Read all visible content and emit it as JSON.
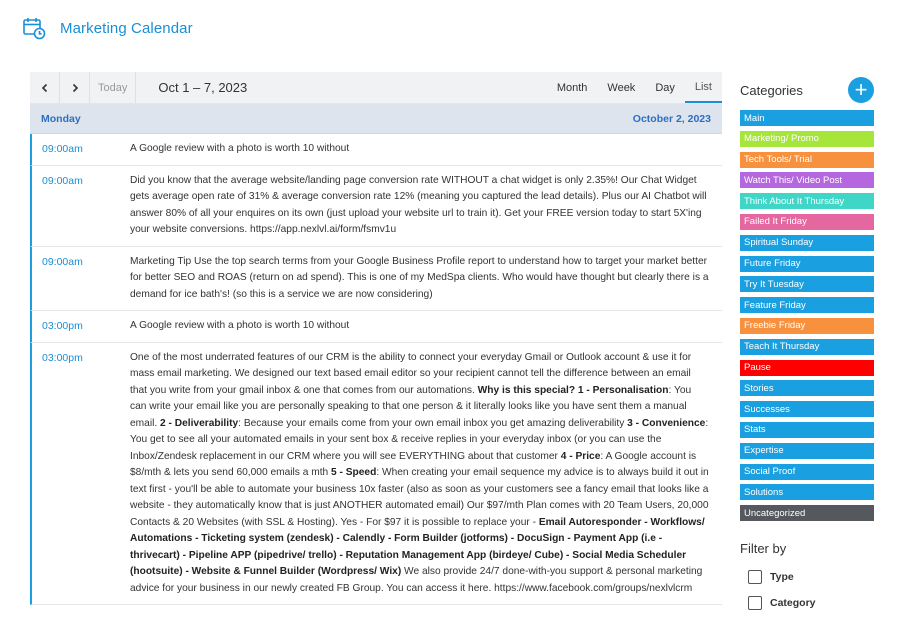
{
  "header": {
    "title": "Marketing Calendar"
  },
  "toolbar": {
    "prev": "‹",
    "next": "›",
    "today": "Today",
    "range": "Oct 1 – 7, 2023",
    "views": [
      "Month",
      "Week",
      "Day",
      "List"
    ],
    "active_view": "List"
  },
  "day": {
    "name": "Monday",
    "date": "October 2, 2023"
  },
  "events": [
    {
      "time": "09:00am",
      "html": "A Google review with a photo is worth 10 without"
    },
    {
      "time": "09:00am",
      "html": "Did you know that the average website/landing page conversion rate WITHOUT a chat widget is only 2.35%! Our Chat Widget gets average open rate of 31% &amp; average conversion rate 12% (meaning you captured the lead details). Plus our AI Chatbot will answer 80% of all your enquires on its own (just upload your website url to train it). Get your FREE version today to start 5X'ing your website conversions. https://app.nexlvl.ai/form/fsmv1u"
    },
    {
      "time": "09:00am",
      "html": "Marketing Tip Use the top search terms from your Google Business Profile report to understand how to target your market better for better SEO and ROAS (return on ad spend). This is one of my MedSpa clients. Who would have thought but clearly there is a demand for ice bath's! (so this is a service we are now considering)"
    },
    {
      "time": "03:00pm",
      "html": "A Google review with a photo is worth 10 without"
    },
    {
      "time": "03:00pm",
      "html": "One of the most underrated features of our CRM is the ability to connect your everyday Gmail or Outlook account &amp; use it for mass email marketing. We designed our text based email editor so your recipient cannot tell the difference between an email that you write from your gmail inbox &amp; one that comes from our automations. <b>Why is this special?</b> <b>1 - Personalisation</b>: You can write your email like you are personally speaking to that one person &amp; it literally looks like you have sent them a manual email. <b>2 - Deliverability</b>: Because your emails come from your own email inbox you get amazing deliverability <b>3 - Convenience</b>: You get to see all your automated emails in your sent box &amp; receive replies in your everyday inbox (or you can use the Inbox/Zendesk replacement in our CRM where you will see EVERYTHING about that customer <b>4 - Price</b>: A Google account is $8/mth &amp; lets you send 60,000 emails a mth <b>5 - Speed</b>: When creating your email sequence my advice is to always build it out in text first - you'll be able to automate your business 10x faster (also as soon as your customers see a fancy email that looks like a website - they automatically know that is just ANOTHER automated email) Our $97/mth Plan comes with 20 Team Users, 20,000 Contacts &amp; 20 Websites (with SSL &amp; Hosting). Yes - For $97 it is possible to replace your - <b>Email Autoresponder - Workflows/ Automations - Ticketing system (zendesk) - Calendly - Form Builder (jotforms) - DocuSign - Payment App</b> <b>(i.e -thrivecart) - Pipeline APP (pipedrive/ trello) - Reputation Management App (birdeye/ Cube) - Social Media Scheduler (hootsuite) - Website &amp; Funnel Builder (Wordpress/ Wix)</b> We also provide 24/7 done-with-you support &amp; personal marketing advice for your business in our newly created FB Group. You can access it here. https://www.facebook.com/groups/nexlvlcrm"
    }
  ],
  "sidebar": {
    "title": "Categories",
    "add_label": "+",
    "categories": [
      {
        "label": "Main",
        "color": "#1a9fe0"
      },
      {
        "label": "Marketing/ Promo",
        "color": "#a6e53a"
      },
      {
        "label": "Tech Tools/ Trial",
        "color": "#f7913e"
      },
      {
        "label": "Watch This/ Video Post",
        "color": "#b567e0"
      },
      {
        "label": "Think About It Thursday",
        "color": "#3fd6c8"
      },
      {
        "label": "Failed It Friday",
        "color": "#e5679f"
      },
      {
        "label": "Spiritual Sunday",
        "color": "#1a9fe0"
      },
      {
        "label": "Future Friday",
        "color": "#1a9fe0"
      },
      {
        "label": "Try It Tuesday",
        "color": "#1a9fe0"
      },
      {
        "label": "Feature Friday",
        "color": "#1a9fe0"
      },
      {
        "label": "Freebie Friday",
        "color": "#f7913e"
      },
      {
        "label": "Teach It Thursday",
        "color": "#1a9fe0"
      },
      {
        "label": "Pause",
        "color": "#ff0000"
      },
      {
        "label": "Stories",
        "color": "#1a9fe0"
      },
      {
        "label": "Successes",
        "color": "#1a9fe0"
      },
      {
        "label": "Stats",
        "color": "#1a9fe0"
      },
      {
        "label": "Expertise",
        "color": "#1a9fe0"
      },
      {
        "label": "Social Proof",
        "color": "#1a9fe0"
      },
      {
        "label": "Solutions",
        "color": "#1a9fe0"
      },
      {
        "label": "Uncategorized",
        "color": "#55585c"
      }
    ],
    "filter_title": "Filter by",
    "filters": [
      "Type",
      "Category"
    ]
  }
}
